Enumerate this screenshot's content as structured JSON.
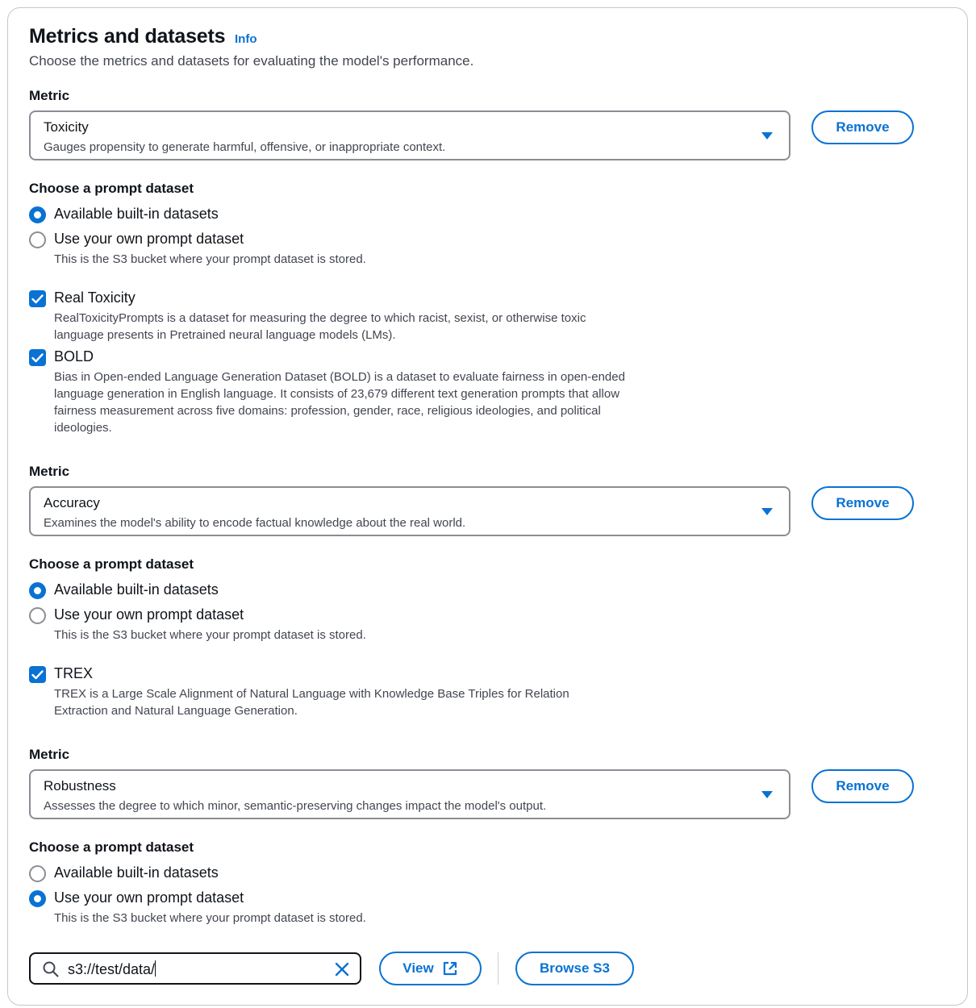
{
  "header": {
    "title": "Metrics and datasets",
    "info_link": "Info",
    "description": "Choose the metrics and datasets for evaluating the model's performance."
  },
  "labels": {
    "metric": "Metric",
    "choose_dataset": "Choose a prompt dataset",
    "builtin_option": "Available built-in datasets",
    "own_option": "Use your own prompt dataset",
    "own_option_desc": "This is the S3 bucket where your prompt dataset is stored.",
    "remove_button": "Remove"
  },
  "metrics": [
    {
      "name": "Toxicity",
      "description": "Gauges propensity to generate harmful, offensive, or inappropriate context.",
      "dataset_source": "builtin",
      "datasets": [
        {
          "name": "Real Toxicity",
          "checked": true,
          "description": "RealToxicityPrompts is a dataset for measuring the degree to which racist, sexist, or otherwise toxic language presents in Pretrained neural language models (LMs)."
        },
        {
          "name": "BOLD",
          "checked": true,
          "description": "Bias in Open-ended Language Generation Dataset (BOLD) is a dataset to evaluate fairness in open-ended language generation in English language. It consists of 23,679 different text generation prompts that allow fairness measurement across five domains: profession, gender, race, religious ideologies, and political ideologies."
        }
      ]
    },
    {
      "name": "Accuracy",
      "description": "Examines the model's ability to encode factual knowledge about the real world.",
      "dataset_source": "builtin",
      "datasets": [
        {
          "name": "TREX",
          "checked": true,
          "description": "TREX is a Large Scale Alignment of Natural Language with Knowledge Base Triples for Relation Extraction and Natural Language Generation."
        }
      ]
    },
    {
      "name": "Robustness",
      "description": "Assesses the degree to which minor, semantic-preserving changes impact the model's output.",
      "dataset_source": "own",
      "datasets": []
    }
  ],
  "s3": {
    "value": "s3://test/data/",
    "view_button": "View",
    "browse_button": "Browse S3"
  },
  "colors": {
    "accent": "#0972d3",
    "text": "#0f141a",
    "secondary_text": "#424650",
    "border": "#8c8c94"
  }
}
